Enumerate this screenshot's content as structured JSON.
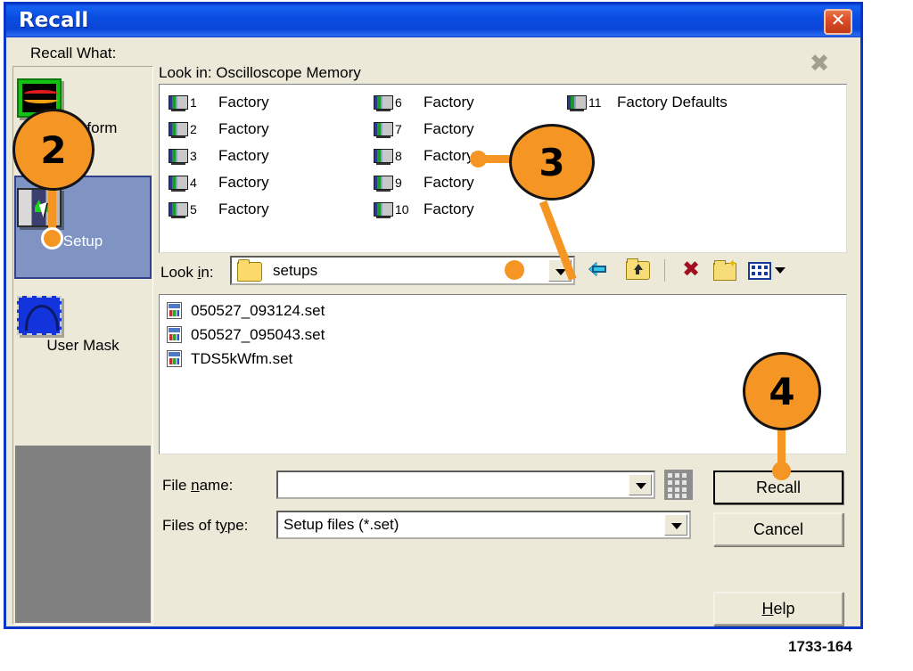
{
  "window": {
    "title": "Recall",
    "close_icon": "close-icon"
  },
  "sidebar": {
    "group_label": "Recall What:",
    "items": [
      {
        "label": "Waveform",
        "icon": "waveform-icon",
        "selected": false
      },
      {
        "label": "Setup",
        "icon": "setup-oscilloscope-icon",
        "selected": true
      },
      {
        "label": "User Mask",
        "icon": "user-mask-icon",
        "selected": false
      }
    ]
  },
  "memory": {
    "heading": "Look in: Oscilloscope Memory",
    "delete_icon": "delete-x-icon-disabled",
    "columns": [
      [
        {
          "num": "1",
          "name": "Factory"
        },
        {
          "num": "2",
          "name": "Factory"
        },
        {
          "num": "3",
          "name": "Factory"
        },
        {
          "num": "4",
          "name": "Factory"
        },
        {
          "num": "5",
          "name": "Factory"
        }
      ],
      [
        {
          "num": "6",
          "name": "Factory"
        },
        {
          "num": "7",
          "name": "Factory"
        },
        {
          "num": "8",
          "name": "Factory"
        },
        {
          "num": "9",
          "name": "Factory"
        },
        {
          "num": "10",
          "name": "Factory"
        }
      ],
      [
        {
          "num": "11",
          "name": "Factory Defaults"
        }
      ]
    ]
  },
  "browser": {
    "lookin_label": "Look in:",
    "lookin_label_pre": "Look ",
    "lookin_label_accel": "i",
    "lookin_label_post": "n:",
    "lookin_value": "setups",
    "lookin_folder_icon": "folder-icon",
    "toolbar": [
      {
        "name": "back-button",
        "icon": "back-arrow-icon"
      },
      {
        "name": "up-one-level-button",
        "icon": "folder-up-icon"
      },
      {
        "name": "delete-button",
        "icon": "delete-x-icon"
      },
      {
        "name": "new-folder-button",
        "icon": "new-folder-icon"
      },
      {
        "name": "views-button",
        "icon": "views-grid-icon"
      }
    ],
    "files": [
      {
        "name": "050527_093124.set",
        "icon": "setup-file-icon"
      },
      {
        "name": "050527_095043.set",
        "icon": "setup-file-icon"
      },
      {
        "name": "TDS5kWfm.set",
        "icon": "setup-file-icon"
      }
    ]
  },
  "form": {
    "filename_label_pre": "File ",
    "filename_label_accel": "n",
    "filename_label_post": "ame:",
    "filename_value": "",
    "filename_placeholder": "",
    "filetype_label_pre": "Files of t",
    "filetype_label_accel": "y",
    "filetype_label_post": "pe:",
    "filetype_value": "Setup files (*.set)",
    "keypad_icon": "virtual-keypad-icon"
  },
  "buttons": {
    "recall": "Recall",
    "cancel": "Cancel",
    "help_pre": "",
    "help_accel": "H",
    "help_post": "elp"
  },
  "callouts": [
    {
      "label": "2"
    },
    {
      "label": "3"
    },
    {
      "label": "4"
    }
  ],
  "figure_id": "1733-164",
  "colors": {
    "titlebar": "#0a4ce0",
    "dialog_face": "#ece9d8",
    "callout": "#f59523",
    "selection": "#8094c4",
    "border_blue": "#0a36c8"
  }
}
